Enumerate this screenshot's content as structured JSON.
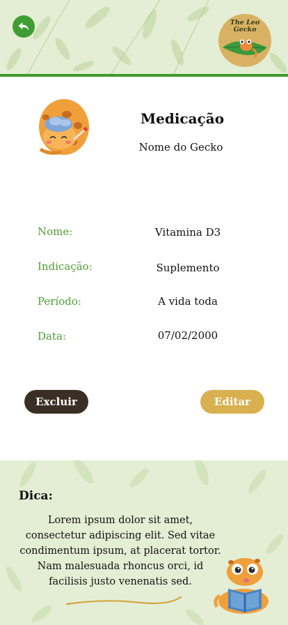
{
  "header": {
    "logo_text": "The Leo Gecko"
  },
  "medication": {
    "title": "Medicação",
    "gecko_name": "Nome do Gecko",
    "fields": [
      {
        "label": "Nome:",
        "value": "Vitamina D3"
      },
      {
        "label": "Indicação:",
        "value": "Suplemento"
      },
      {
        "label": "Período:",
        "value": "A vida toda"
      },
      {
        "label": "Data:",
        "value": "07/02/2000"
      }
    ]
  },
  "actions": {
    "delete_label": "Excluir",
    "edit_label": "Editar"
  },
  "tip": {
    "title": "Dica:",
    "text": "Lorem ipsum dolor sit amet, consectetur adipiscing elit. Sed vitae condimentum ipsum, at placerat tortor. Nam malesuada rhoncus orci, id facilisis justo venenatis sed."
  },
  "colors": {
    "accent_green": "#3e9a2e",
    "label_green": "#4f9e33",
    "delete_button": "#3a2f24",
    "edit_button": "#d9b050",
    "panel_bg": "#e4eed4"
  },
  "icons": {
    "back": "back-arrow-icon",
    "avatar": "sick-gecko-illustration",
    "tip_mascot": "reading-gecko-illustration"
  }
}
